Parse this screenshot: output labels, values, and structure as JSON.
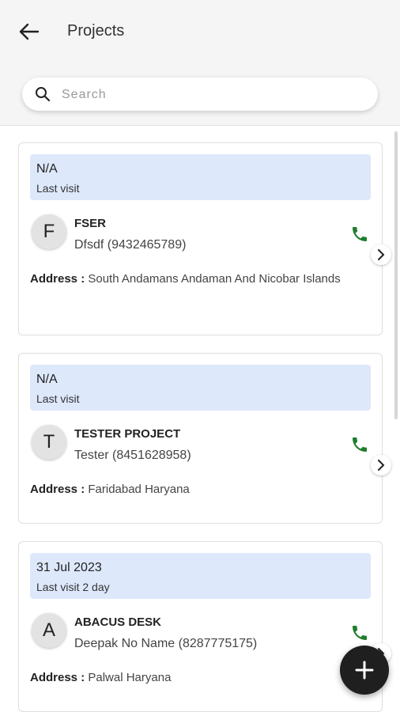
{
  "header": {
    "title": "Projects",
    "back_icon": "arrow-left-icon"
  },
  "search": {
    "placeholder": "Search",
    "value": ""
  },
  "projects": [
    {
      "visit_date": "N/A",
      "visit_label": "Last visit",
      "initial": "F",
      "company": "FSER",
      "contact": "Dfsdf (9432465789)",
      "address_label": "Address :",
      "address": "South Andamans Andaman And Nicobar Islands"
    },
    {
      "visit_date": "N/A",
      "visit_label": "Last visit",
      "initial": "T",
      "company": "TESTER PROJECT",
      "contact": "Tester (8451628958)",
      "address_label": "Address :",
      "address": "Faridabad Haryana"
    },
    {
      "visit_date": "31 Jul 2023",
      "visit_label": "Last visit 2 day",
      "initial": "A",
      "company": "ABACUS DESK",
      "contact": "Deepak No Name (8287775175)",
      "address_label": "Address :",
      "address": "Palwal Haryana"
    }
  ],
  "colors": {
    "visit_box": "#dde8fb",
    "phone_icon": "#1e7d2c",
    "fab": "#1f1f1f"
  },
  "fab": {
    "icon": "plus-icon"
  }
}
